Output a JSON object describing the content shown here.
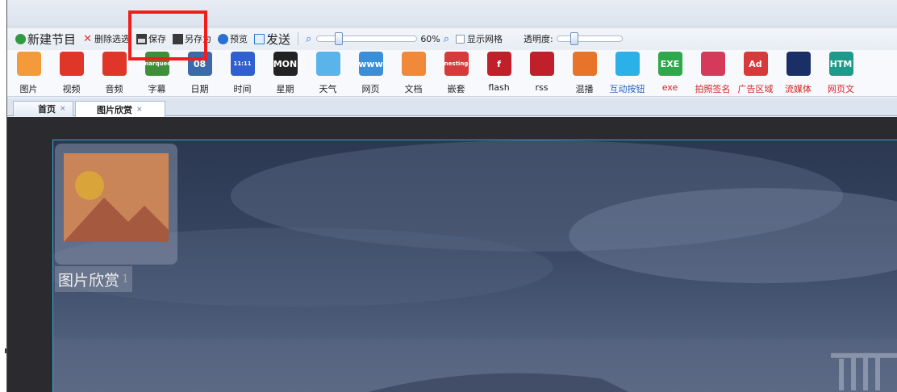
{
  "toolbar": {
    "new_program": "新建节目",
    "delete_selected": "删除选选",
    "save": "保存",
    "save_as": "另存为",
    "preview": "预览",
    "publish": "发送",
    "zoom_value": "60%",
    "zoom_level": 0.6,
    "show_grid": "显示网格",
    "opacity_label": "透明度:"
  },
  "ribbon": {
    "items": [
      {
        "label": "图片",
        "icon": "picture-icon",
        "color": "#f39b3a"
      },
      {
        "label": "视频",
        "icon": "video-icon",
        "color": "#e0362a"
      },
      {
        "label": "音频",
        "icon": "music-icon",
        "color": "#e0362a"
      },
      {
        "label": "字幕",
        "icon": "marquee-icon",
        "color": "#3f8f3a",
        "glyph": "marquee"
      },
      {
        "label": "日期",
        "icon": "calendar-icon",
        "color": "#3b6aa8",
        "glyph": "08"
      },
      {
        "label": "时间",
        "icon": "clock-icon",
        "color": "#2f5fd0",
        "glyph": "11:11"
      },
      {
        "label": "星期",
        "icon": "week-icon",
        "color": "#222222",
        "glyph": "MON"
      },
      {
        "label": "天气",
        "icon": "weather-icon",
        "color": "#59b4ea"
      },
      {
        "label": "网页",
        "icon": "webpage-icon",
        "color": "#3b8ed8",
        "glyph": "www"
      },
      {
        "label": "文档",
        "icon": "document-icon",
        "color": "#f08a3a"
      },
      {
        "label": "嵌套",
        "icon": "nesting-icon",
        "color": "#d63a3a",
        "glyph": "nesting"
      },
      {
        "label": "flash",
        "icon": "flash-icon",
        "color": "#c0202a",
        "glyph": "f"
      },
      {
        "label": "rss",
        "icon": "rss-icon",
        "color": "#c0202a"
      },
      {
        "label": "混播",
        "icon": "mixed-play-icon",
        "color": "#e8742a"
      },
      {
        "label": "互动按钮",
        "icon": "touch-button-icon",
        "color": "#2cb0e8",
        "style": "blue"
      },
      {
        "label": "exe",
        "icon": "exe-icon",
        "color": "#2ea84a",
        "glyph": "EXE",
        "style": "red"
      },
      {
        "label": "拍照签名",
        "icon": "camera-icon",
        "color": "#d63a5a",
        "style": "red"
      },
      {
        "label": "广告区域",
        "icon": "ad-icon",
        "color": "#d63a3a",
        "glyph": "Ad",
        "style": "red"
      },
      {
        "label": "流媒体",
        "icon": "streaming-icon",
        "color": "#1a2f66",
        "style": "red"
      },
      {
        "label": "网页文",
        "icon": "html-icon",
        "color": "#1e9a8a",
        "glyph": "HTM",
        "style": "red"
      }
    ]
  },
  "tabs": [
    {
      "label": "首页",
      "close": "×"
    },
    {
      "label": "图片欣赏",
      "close": "×"
    }
  ],
  "canvas": {
    "caption": "图片欣赏",
    "caption_cursor": "1"
  },
  "colors": {
    "highlight": "#f21c1c",
    "canvas_border": "#3ea7cf",
    "blue_label": "#1f5fbf",
    "red_label": "#d62020"
  }
}
